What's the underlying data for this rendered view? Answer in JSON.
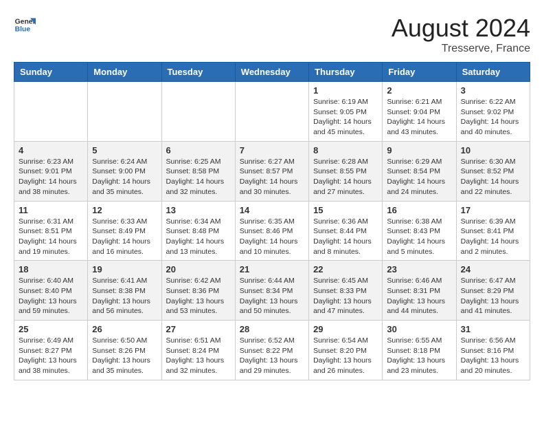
{
  "header": {
    "logo": {
      "general": "General",
      "blue": "Blue"
    },
    "title": "August 2024",
    "subtitle": "Tresserve, France"
  },
  "days_of_week": [
    "Sunday",
    "Monday",
    "Tuesday",
    "Wednesday",
    "Thursday",
    "Friday",
    "Saturday"
  ],
  "weeks": [
    [
      {
        "day": "",
        "content": ""
      },
      {
        "day": "",
        "content": ""
      },
      {
        "day": "",
        "content": ""
      },
      {
        "day": "",
        "content": ""
      },
      {
        "day": "1",
        "content": "Sunrise: 6:19 AM\nSunset: 9:05 PM\nDaylight: 14 hours and 45 minutes."
      },
      {
        "day": "2",
        "content": "Sunrise: 6:21 AM\nSunset: 9:04 PM\nDaylight: 14 hours and 43 minutes."
      },
      {
        "day": "3",
        "content": "Sunrise: 6:22 AM\nSunset: 9:02 PM\nDaylight: 14 hours and 40 minutes."
      }
    ],
    [
      {
        "day": "4",
        "content": "Sunrise: 6:23 AM\nSunset: 9:01 PM\nDaylight: 14 hours and 38 minutes."
      },
      {
        "day": "5",
        "content": "Sunrise: 6:24 AM\nSunset: 9:00 PM\nDaylight: 14 hours and 35 minutes."
      },
      {
        "day": "6",
        "content": "Sunrise: 6:25 AM\nSunset: 8:58 PM\nDaylight: 14 hours and 32 minutes."
      },
      {
        "day": "7",
        "content": "Sunrise: 6:27 AM\nSunset: 8:57 PM\nDaylight: 14 hours and 30 minutes."
      },
      {
        "day": "8",
        "content": "Sunrise: 6:28 AM\nSunset: 8:55 PM\nDaylight: 14 hours and 27 minutes."
      },
      {
        "day": "9",
        "content": "Sunrise: 6:29 AM\nSunset: 8:54 PM\nDaylight: 14 hours and 24 minutes."
      },
      {
        "day": "10",
        "content": "Sunrise: 6:30 AM\nSunset: 8:52 PM\nDaylight: 14 hours and 22 minutes."
      }
    ],
    [
      {
        "day": "11",
        "content": "Sunrise: 6:31 AM\nSunset: 8:51 PM\nDaylight: 14 hours and 19 minutes."
      },
      {
        "day": "12",
        "content": "Sunrise: 6:33 AM\nSunset: 8:49 PM\nDaylight: 14 hours and 16 minutes."
      },
      {
        "day": "13",
        "content": "Sunrise: 6:34 AM\nSunset: 8:48 PM\nDaylight: 14 hours and 13 minutes."
      },
      {
        "day": "14",
        "content": "Sunrise: 6:35 AM\nSunset: 8:46 PM\nDaylight: 14 hours and 10 minutes."
      },
      {
        "day": "15",
        "content": "Sunrise: 6:36 AM\nSunset: 8:44 PM\nDaylight: 14 hours and 8 minutes."
      },
      {
        "day": "16",
        "content": "Sunrise: 6:38 AM\nSunset: 8:43 PM\nDaylight: 14 hours and 5 minutes."
      },
      {
        "day": "17",
        "content": "Sunrise: 6:39 AM\nSunset: 8:41 PM\nDaylight: 14 hours and 2 minutes."
      }
    ],
    [
      {
        "day": "18",
        "content": "Sunrise: 6:40 AM\nSunset: 8:40 PM\nDaylight: 13 hours and 59 minutes."
      },
      {
        "day": "19",
        "content": "Sunrise: 6:41 AM\nSunset: 8:38 PM\nDaylight: 13 hours and 56 minutes."
      },
      {
        "day": "20",
        "content": "Sunrise: 6:42 AM\nSunset: 8:36 PM\nDaylight: 13 hours and 53 minutes."
      },
      {
        "day": "21",
        "content": "Sunrise: 6:44 AM\nSunset: 8:34 PM\nDaylight: 13 hours and 50 minutes."
      },
      {
        "day": "22",
        "content": "Sunrise: 6:45 AM\nSunset: 8:33 PM\nDaylight: 13 hours and 47 minutes."
      },
      {
        "day": "23",
        "content": "Sunrise: 6:46 AM\nSunset: 8:31 PM\nDaylight: 13 hours and 44 minutes."
      },
      {
        "day": "24",
        "content": "Sunrise: 6:47 AM\nSunset: 8:29 PM\nDaylight: 13 hours and 41 minutes."
      }
    ],
    [
      {
        "day": "25",
        "content": "Sunrise: 6:49 AM\nSunset: 8:27 PM\nDaylight: 13 hours and 38 minutes."
      },
      {
        "day": "26",
        "content": "Sunrise: 6:50 AM\nSunset: 8:26 PM\nDaylight: 13 hours and 35 minutes."
      },
      {
        "day": "27",
        "content": "Sunrise: 6:51 AM\nSunset: 8:24 PM\nDaylight: 13 hours and 32 minutes."
      },
      {
        "day": "28",
        "content": "Sunrise: 6:52 AM\nSunset: 8:22 PM\nDaylight: 13 hours and 29 minutes."
      },
      {
        "day": "29",
        "content": "Sunrise: 6:54 AM\nSunset: 8:20 PM\nDaylight: 13 hours and 26 minutes."
      },
      {
        "day": "30",
        "content": "Sunrise: 6:55 AM\nSunset: 8:18 PM\nDaylight: 13 hours and 23 minutes."
      },
      {
        "day": "31",
        "content": "Sunrise: 6:56 AM\nSunset: 8:16 PM\nDaylight: 13 hours and 20 minutes."
      }
    ]
  ]
}
